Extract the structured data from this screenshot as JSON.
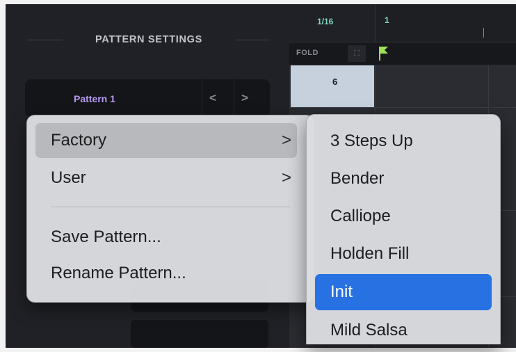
{
  "pattern_settings": {
    "section_title": "PATTERN SETTINGS",
    "current_pattern": "Pattern 1",
    "prev_glyph": "<",
    "next_glyph": ">"
  },
  "sequencer": {
    "rate": "1/16",
    "step_number": "1",
    "fold_label": "FOLD",
    "lane_value": "6"
  },
  "context_menu": {
    "items": [
      {
        "label": "Factory",
        "has_submenu": true,
        "highlighted": true
      },
      {
        "label": "User",
        "has_submenu": true
      },
      {
        "label": "Save Pattern..."
      },
      {
        "label": "Rename Pattern..."
      }
    ],
    "chevron": ">"
  },
  "factory_submenu": {
    "items": [
      {
        "label": "3 Steps Up"
      },
      {
        "label": "Bender"
      },
      {
        "label": "Calliope"
      },
      {
        "label": "Holden Fill"
      },
      {
        "label": "Init",
        "selected": true
      },
      {
        "label": "Mild Salsa"
      }
    ]
  },
  "colors": {
    "pattern_name": "#b79bf5",
    "rate_text": "#7ed6c2",
    "selection_blue": "#2771e3"
  }
}
